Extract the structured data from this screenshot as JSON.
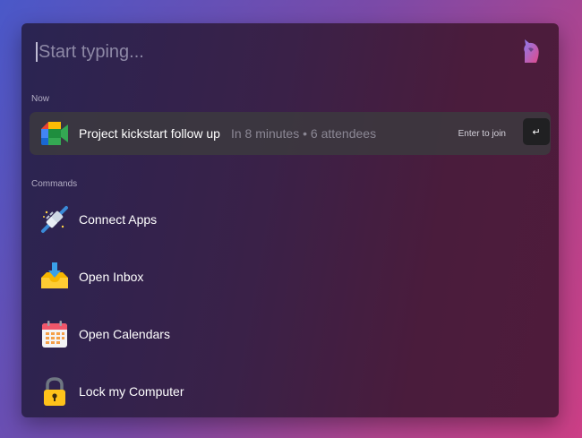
{
  "search": {
    "placeholder": "Start typing..."
  },
  "sections": {
    "now": "Now",
    "commands": "Commands"
  },
  "now_item": {
    "title": "Project kickstart follow up",
    "meta": "In 8 minutes • 6 attendees",
    "hint": "Enter to join",
    "key": "↵",
    "icon": "google-meet-icon"
  },
  "commands": [
    {
      "label": "Connect Apps",
      "icon": "plug-icon"
    },
    {
      "label": "Open Inbox",
      "icon": "inbox-icon"
    },
    {
      "label": "Open Calendars",
      "icon": "calendar-icon"
    },
    {
      "label": "Lock my Computer",
      "icon": "lock-icon"
    }
  ],
  "colors": {
    "accent_gradient_left": "#4a58c8",
    "accent_gradient_right": "#cc3f86",
    "panel_left": "#2a2452",
    "panel_right": "#4f1b3b",
    "row_highlight": "#3c3a3e"
  }
}
